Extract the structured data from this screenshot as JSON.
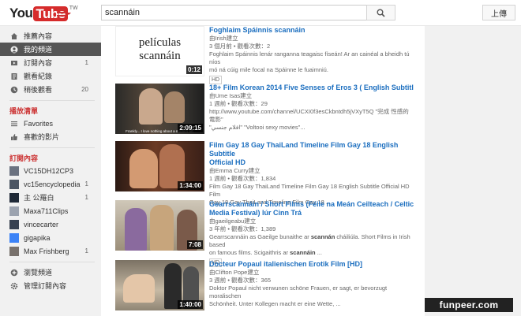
{
  "header": {
    "logo_you": "You",
    "logo_tube": "Tube",
    "logo_region": "TW",
    "search_value": "scannáin",
    "upload_label": "上傳"
  },
  "sidebar": {
    "top_items": [
      {
        "label": "推薦內容",
        "icon": "home-icon",
        "count": ""
      },
      {
        "label": "我的頻道",
        "icon": "person-icon",
        "count": ""
      },
      {
        "label": "訂閱內容",
        "icon": "subscriptions-icon",
        "count": "1"
      },
      {
        "label": "觀看紀錄",
        "icon": "history-icon",
        "count": ""
      },
      {
        "label": "稍後觀看",
        "icon": "clock-icon",
        "count": "20"
      }
    ],
    "playlists_heading": "播放清單",
    "playlists": [
      {
        "label": "Favorites",
        "icon": "list-icon"
      },
      {
        "label": "喜歡的影片",
        "icon": "thumbs-up-icon"
      }
    ],
    "subs_heading": "訂閱內容",
    "subscriptions": [
      {
        "label": "VC15DH12CP3",
        "count": "",
        "color": "#6b7280"
      },
      {
        "label": "vc15encyclopedia",
        "count": "1",
        "color": "#4b5563"
      },
      {
        "label": "主 公羅白",
        "count": "1",
        "color": "#1f2937"
      },
      {
        "label": "Maxa711Clips",
        "count": "",
        "color": "#9ca3af"
      },
      {
        "label": "vincecarter",
        "count": "",
        "color": "#374151"
      },
      {
        "label": "gigapika",
        "count": "",
        "color": "#3b82f6"
      },
      {
        "label": "Max Frishberg",
        "count": "1",
        "color": "#78716c"
      }
    ],
    "bottom_items": [
      {
        "label": "瀏覽頻道",
        "icon": "plus-circle-icon"
      },
      {
        "label": "管理訂閱內容",
        "icon": "gear-icon"
      }
    ]
  },
  "results": [
    {
      "title": "Foghlaim Spáinnis scannáin",
      "channel": "由Irish建立",
      "meta": "3 個月前 • 觀看次數：2",
      "desc1": "Foghlaim Spáinnis lenár ranganna teagaisc físeán! Ar an cainéal a bheidh tú níos",
      "desc2": "mó ná cúig mile focal na Spáinne le fuaimniú.",
      "badge": "HD",
      "duration": "0:12",
      "thumb_text_1": "películas",
      "thumb_text_2": "scannáin"
    },
    {
      "title": "18+ Film Korean 2014 Five Senses of Eros 3 ( English Subtitl",
      "channel": "由Ume Isas建立",
      "meta": "1 週前 • 觀看次數：29",
      "desc1": "http://www.youtube.com/channel/UCXI0f3esCkbntdh5jVXyT5Q \"完成 性感的 電影\"",
      "desc2": "\"افلام جنسي\" \"Voltooi sexy movies\"...",
      "badge": "",
      "duration": "2:09:15",
      "subtitle": "Frankly... I love nothing about a modern art."
    },
    {
      "title": "Film Gay 18 Gay ThaiLand Timeline Film Gay 18 English Subtitle",
      "title2": "Official HD",
      "channel": "由Emma Curry建立",
      "meta": "1 週前 • 觀看次數：1,834",
      "desc1": "Film Gay 18 Gay ThaiLand Timeline Film Gay 18 English Subtitle Official HD Film",
      "desc2": "Gay 18 Gay ThaiLand Timeline Film Gay 18 ...",
      "badge": "",
      "duration": "1:34:00"
    },
    {
      "title": "Gearrscannáin / Short Films (Féile na Meán Ceilteach / Celtic",
      "title2": "Media Festival) lúr Cinn Trá",
      "channel": "由gaeilgeabu建立",
      "meta": "3 年前 • 觀看次數：1,389",
      "desc1_pre": "Gearrscannáin as Gaeilge bunaithe ar ",
      "desc1_kw": "scannán",
      "desc1_post": " cháiliúla. Short Films in Irish based",
      "desc2_pre": "on famous films. Scigaithris ar ",
      "desc2_kw": "scannáin",
      "desc2_post": " ...",
      "badge": "HD",
      "duration": "7:08"
    },
    {
      "title": "Docteur Popaul italienischen Erotik Film [HD]",
      "channel": "由Clifton Pope建立",
      "meta": "3 週前 • 觀看次數：365",
      "desc1": "Doktor Popaul nicht verwunen schöne Frauen, er sagt, er bevorzugt moralischen",
      "desc2": "Schönheit. Unter Kollegen macht er eine Wette, ...",
      "badge": "",
      "duration": "1:40:00"
    }
  ],
  "watermark": "funpeer.com",
  "colors": {
    "brand_red": "#d62b2b",
    "link_blue": "#1b6ebf",
    "selected_bg": "#555555"
  }
}
